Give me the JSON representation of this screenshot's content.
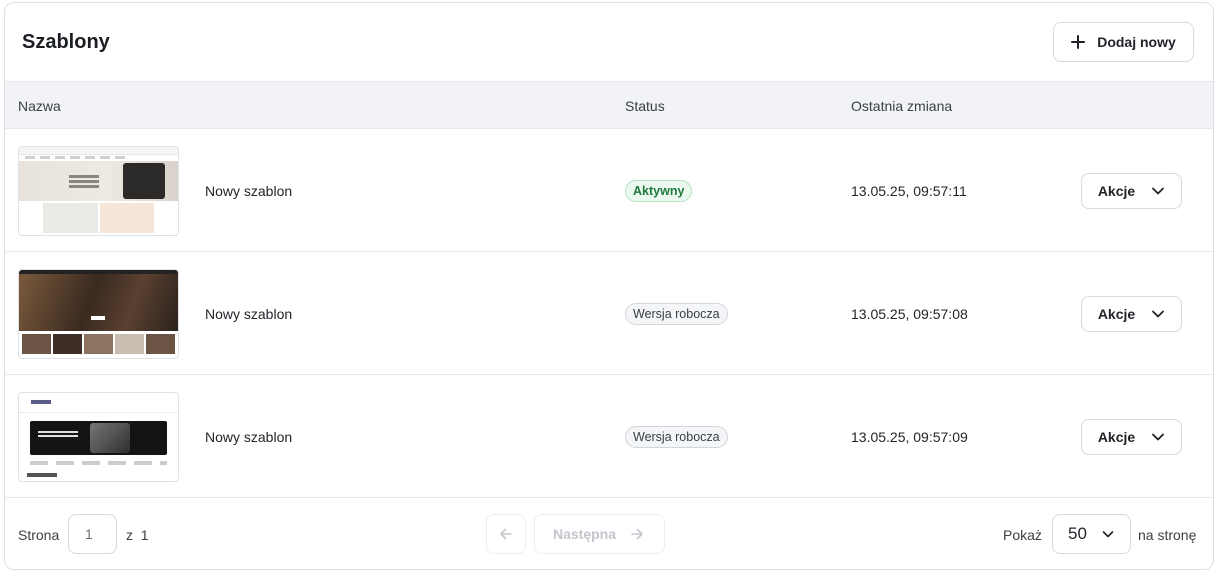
{
  "header": {
    "title": "Szablony",
    "add_label": "Dodaj nowy"
  },
  "table": {
    "columns": [
      "Nazwa",
      "Status",
      "Ostatnia zmiana"
    ],
    "rows": [
      {
        "name": "Nowy szablon",
        "status": "Aktywny",
        "status_kind": "active",
        "changed": "13.05.25, 09:57:11",
        "actions_label": "Akcje"
      },
      {
        "name": "Nowy szablon",
        "status": "Wersja robocza",
        "status_kind": "draft",
        "changed": "13.05.25, 09:57:08",
        "actions_label": "Akcje"
      },
      {
        "name": "Nowy szablon",
        "status": "Wersja robocza",
        "status_kind": "draft",
        "changed": "13.05.25, 09:57:09",
        "actions_label": "Akcje"
      }
    ]
  },
  "pagination": {
    "page_label": "Strona",
    "page_value": "1",
    "of_label": "z",
    "total_pages": "1",
    "next_label": "Następna",
    "show_label": "Pokaż",
    "per_page_value": "50",
    "per_page_suffix": "na stronę"
  },
  "colors": {
    "accent_active": "#1f7a3d",
    "header_bg": "#f1f3f6",
    "border": "#dcdfe4"
  }
}
